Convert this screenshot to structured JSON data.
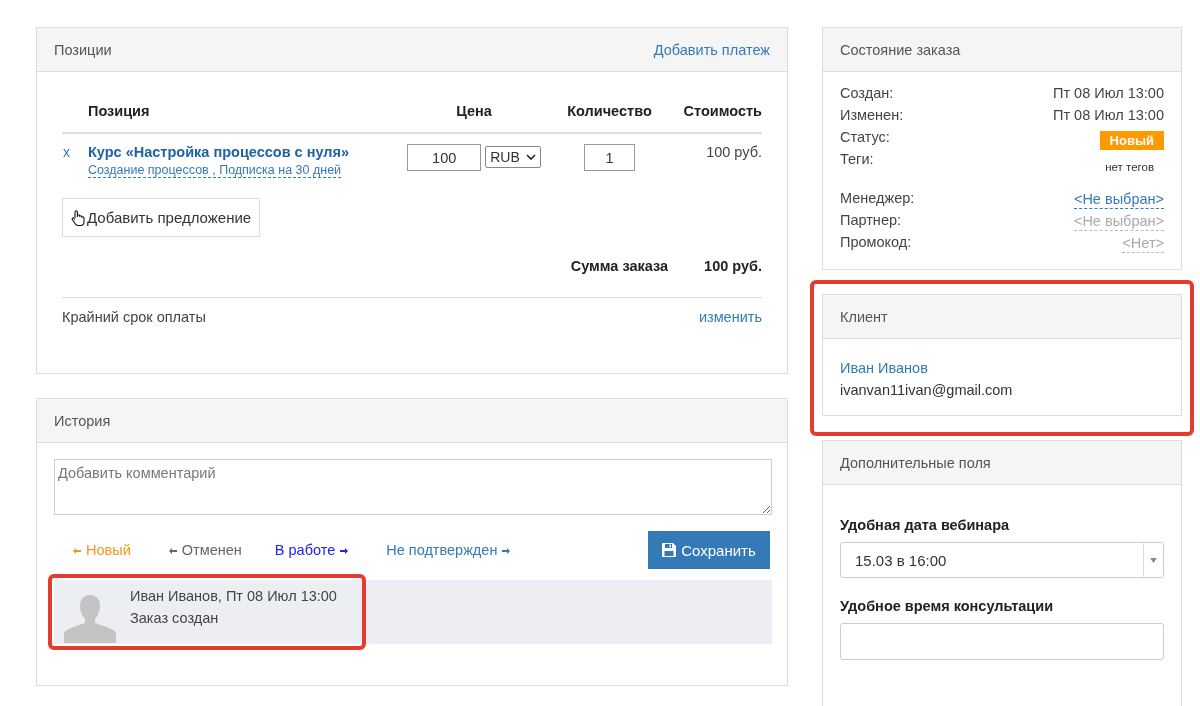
{
  "positions": {
    "title": "Позиции",
    "action": "Добавить платеж",
    "columns": [
      "Позиция",
      "Цена",
      "Количество",
      "Стоимость"
    ],
    "items": [
      {
        "remove": "x",
        "name": "Курс «Настройка процессов с нуля»",
        "offers": "Создание процессов , Подписка на 30 дней",
        "price": "100",
        "currency": "RUB",
        "quantity": "1",
        "cost": "100 руб."
      }
    ],
    "add_offer": "Добавить предложение",
    "total_label": "Сумма заказа",
    "total": "100 руб.",
    "deadline_label": "Крайний срок оплаты",
    "deadline_action": "изменить"
  },
  "history": {
    "title": "История",
    "comment_placeholder": "Добавить комментарий",
    "transitions": [
      {
        "label": "Новый",
        "kind": "back",
        "color": "#f7941d"
      },
      {
        "label": "Отменен",
        "kind": "back",
        "color": "#666666"
      },
      {
        "label": "В работе",
        "kind": "forward",
        "color": "#2222ee"
      },
      {
        "label": "Не подтвержден",
        "kind": "forward",
        "color": "#337ab7"
      }
    ],
    "save": "Сохранить",
    "entries": [
      {
        "header": "Иван Иванов, Пт 08 Июл 13:00",
        "text": "Заказ создан",
        "highlighted": true
      }
    ]
  },
  "order_state": {
    "title": "Состояние заказа",
    "rows": [
      {
        "label": "Создан:",
        "kind": "text",
        "value": "Пт 08 Июл 13:00"
      },
      {
        "label": "Изменен:",
        "kind": "text",
        "value": "Пт 08 Июл 13:00"
      },
      {
        "label": "Статус:",
        "kind": "badge",
        "value": "Новый"
      },
      {
        "label": "Теги:",
        "kind": "note",
        "value": "нет тегов"
      }
    ],
    "assignments": [
      {
        "label": "Менеджер:",
        "kind": "link",
        "value": "<Не выбран>"
      },
      {
        "label": "Партнер:",
        "kind": "muted",
        "value": "<Не выбран>"
      },
      {
        "label": "Промокод:",
        "kind": "muted",
        "value": "<Нет>"
      }
    ]
  },
  "client": {
    "title": "Клиент",
    "name": "Иван Иванов",
    "email": "ivanvan11ivan@gmail.com",
    "highlighted": true
  },
  "extra_fields": {
    "title": "Дополнительные поля",
    "fields": [
      {
        "label": "Удобная дата вебинара",
        "kind": "select",
        "value": "15.03 в 16:00"
      },
      {
        "label": "Удобное время консультации",
        "kind": "text"
      }
    ]
  }
}
